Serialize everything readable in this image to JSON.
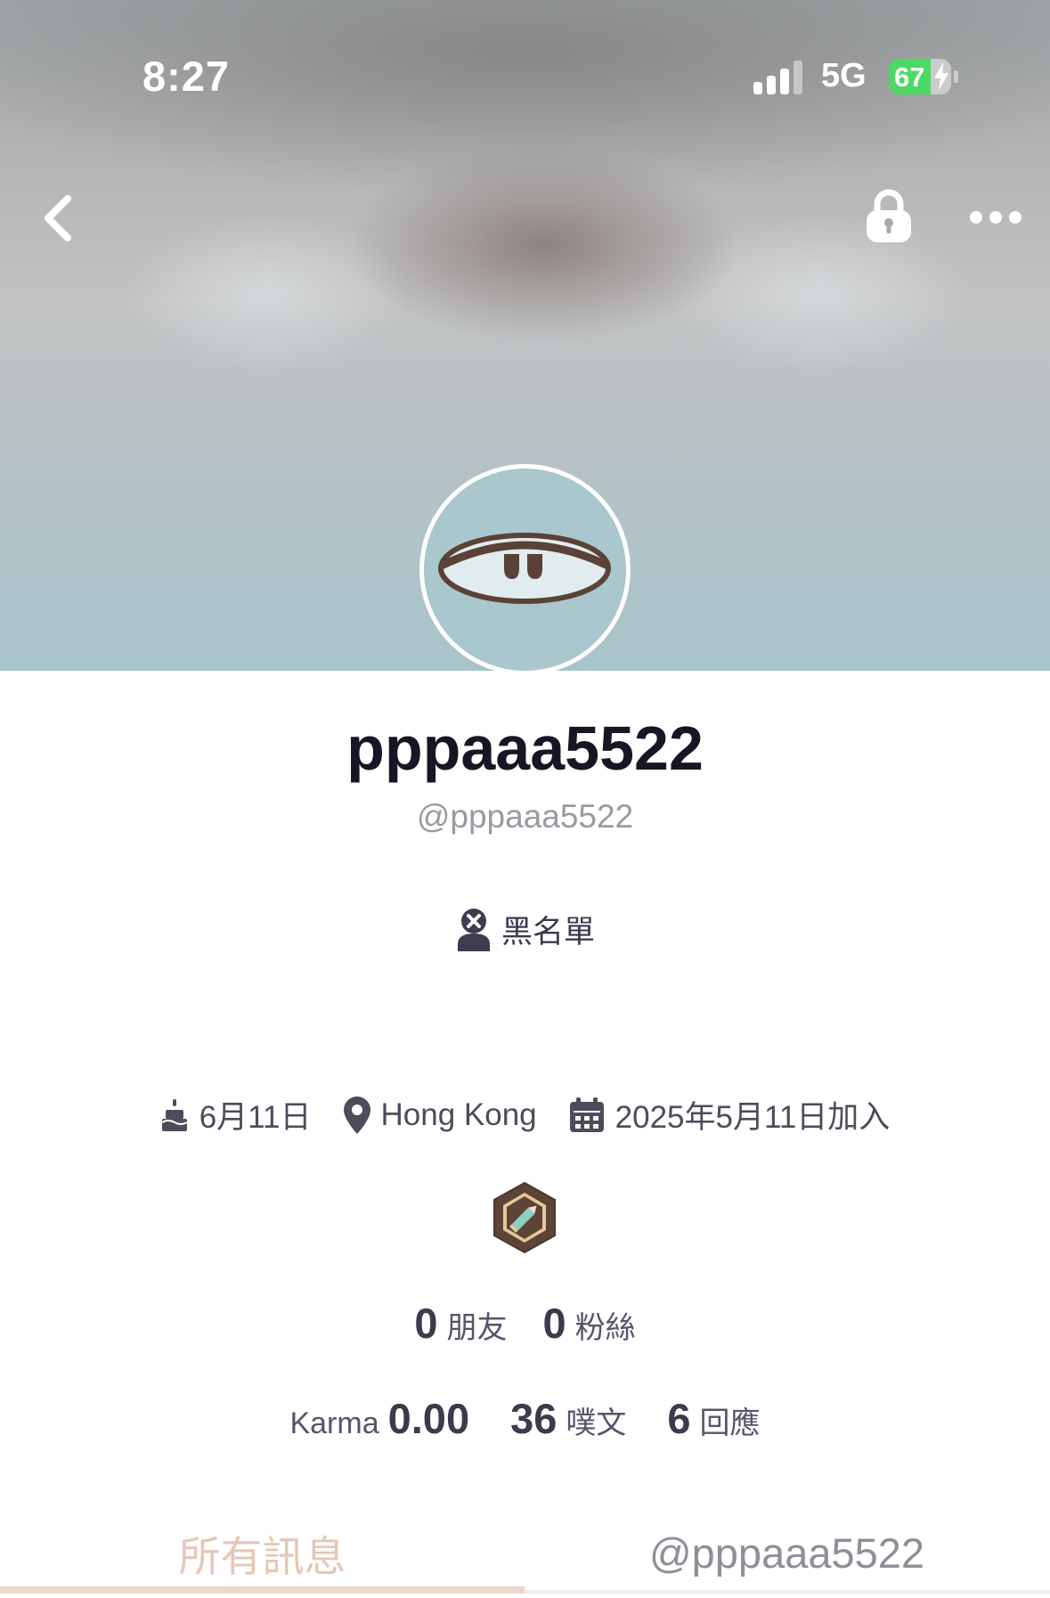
{
  "status_bar": {
    "time": "8:27",
    "network": "5G",
    "battery": "67",
    "battery_level": 0.67,
    "charging": true
  },
  "profile": {
    "display_name": "pppaaa5522",
    "handle": "@pppaaa5522",
    "blacklist_label": "黑名單",
    "birthday": "6月11日",
    "location": "Hong Kong",
    "joined": "2025年5月11日加入"
  },
  "counts": {
    "friends_value": "0",
    "friends_label": "朋友",
    "fans_value": "0",
    "fans_label": "粉絲"
  },
  "stats": {
    "karma_label": "Karma",
    "karma_value": "0.00",
    "plurks_value": "36",
    "plurks_label": "噗文",
    "responses_value": "6",
    "responses_label": "回應"
  },
  "tabs": [
    {
      "label": "所有訊息",
      "active": true
    },
    {
      "label": "@pppaaa5522",
      "active": false
    }
  ],
  "colors": {
    "active_tab": "#e6c7b7",
    "inactive_tab": "#8f8f98",
    "battery_green": "#4cd964",
    "avatar_bg": "#a9c7cd"
  },
  "icons": [
    "back-icon",
    "lock-icon",
    "more-icon",
    "blocked-user-icon",
    "cake-icon",
    "location-pin-icon",
    "calendar-icon",
    "pencil-badge-icon"
  ]
}
